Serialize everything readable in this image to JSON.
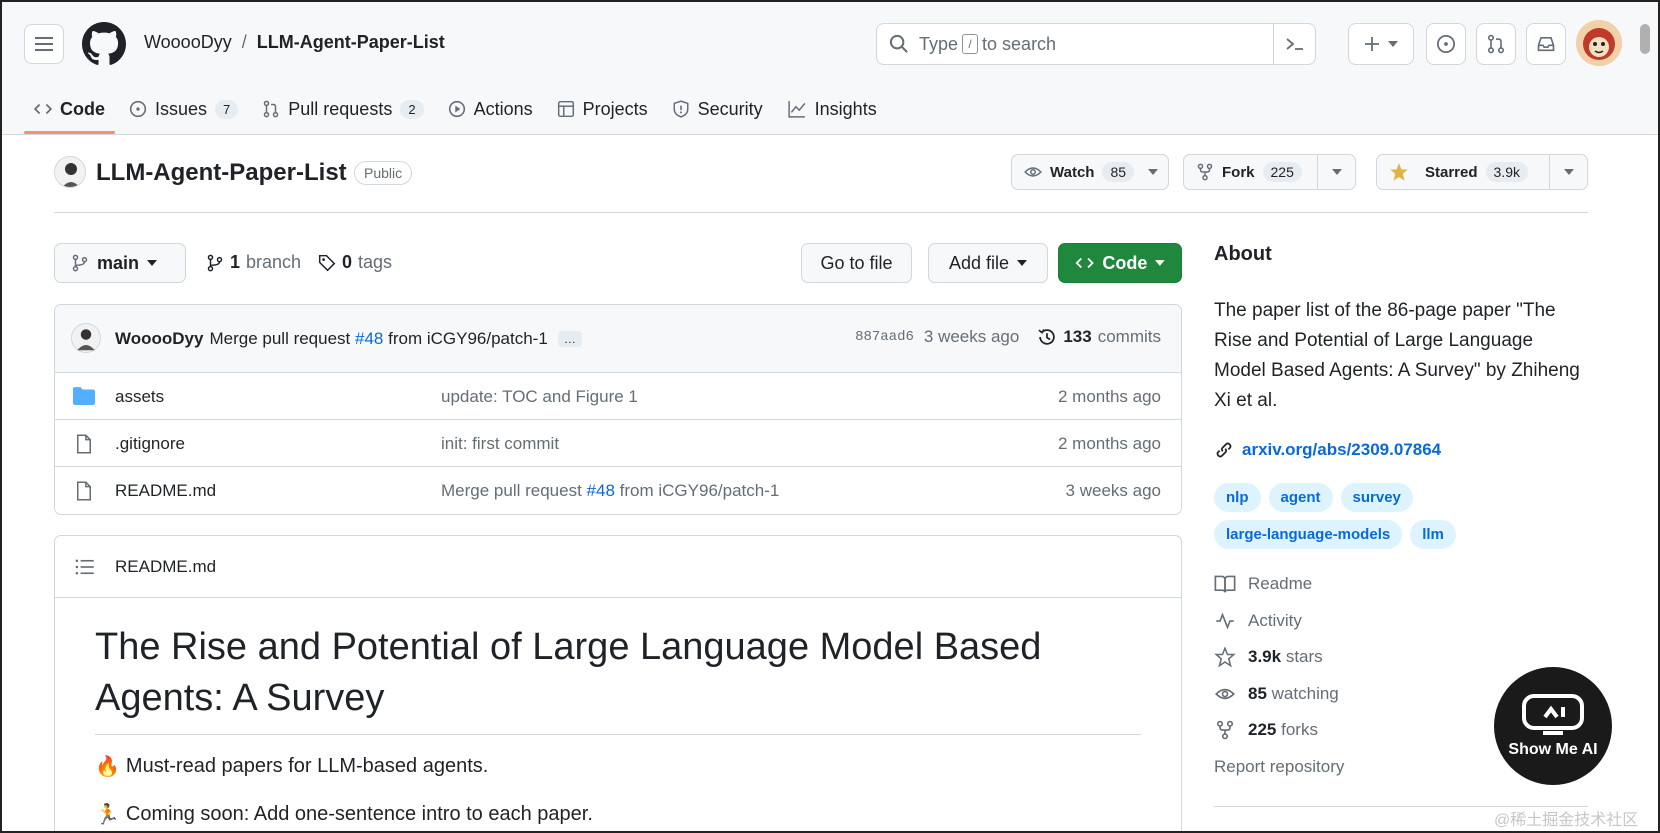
{
  "header": {
    "owner": "WooooDyy",
    "separator": "/",
    "repo": "LLM-Agent-Paper-List",
    "search_prefix": "Type",
    "search_key": "/",
    "search_suffix": "to search"
  },
  "tabs": [
    {
      "label": "Code",
      "icon": "code-icon",
      "active": true
    },
    {
      "label": "Issues",
      "count": "7",
      "icon": "issue-icon"
    },
    {
      "label": "Pull requests",
      "count": "2",
      "icon": "pull-request-icon"
    },
    {
      "label": "Actions",
      "icon": "play-icon"
    },
    {
      "label": "Projects",
      "icon": "table-icon"
    },
    {
      "label": "Security",
      "icon": "shield-icon"
    },
    {
      "label": "Insights",
      "icon": "graph-icon"
    }
  ],
  "repo": {
    "name": "LLM-Agent-Paper-List",
    "visibility": "Public",
    "watch_label": "Watch",
    "watch_count": "85",
    "fork_label": "Fork",
    "fork_count": "225",
    "star_label": "Starred",
    "star_count": "3.9k"
  },
  "branchbar": {
    "branch": "main",
    "branch_count": "1",
    "branch_word": "branch",
    "tag_count": "0",
    "tag_word": "tags",
    "go_to_file": "Go to file",
    "add_file": "Add file",
    "code": "Code"
  },
  "commit": {
    "author": "WooooDyy",
    "msg_prefix": "Merge pull request",
    "pr": "#48",
    "msg_suffix": "from iCGY96/patch-1",
    "ellipsis": "…",
    "sha": "887aad6",
    "when": "3 weeks ago",
    "commit_count": "133",
    "commit_word": "commits"
  },
  "files": [
    {
      "name": "assets",
      "type": "folder",
      "msg": "update: TOC and Figure 1",
      "date": "2 months ago"
    },
    {
      "name": ".gitignore",
      "type": "file",
      "msg": "init: first commit",
      "date": "2 months ago"
    },
    {
      "name": "README.md",
      "type": "file",
      "msg_prefix": "Merge pull request",
      "msg_pr": "#48",
      "msg_suffix": "from iCGY96/patch-1",
      "date": "3 weeks ago"
    }
  ],
  "readme": {
    "filename": "README.md",
    "title": "The Rise and Potential of Large Language Model Based Agents: A Survey",
    "line1_emoji": "🔥",
    "line1": "Must-read papers for LLM-based agents.",
    "line2_emoji": "🏃",
    "line2": "Coming soon: Add one-sentence intro to each paper."
  },
  "about": {
    "heading": "About",
    "description": "The paper list of the 86-page paper \"The Rise and Potential of Large Language Model Based Agents: A Survey\" by Zhiheng Xi et al.",
    "url": "arxiv.org/abs/2309.07864",
    "topics": [
      "nlp",
      "agent",
      "survey",
      "large-language-models",
      "llm"
    ],
    "readme": "Readme",
    "activity": "Activity",
    "stars_count": "3.9k",
    "stars_word": "stars",
    "watching_count": "85",
    "watching_word": "watching",
    "forks_count": "225",
    "forks_word": "forks",
    "report": "Report repository"
  },
  "overlay": {
    "badge": "Show Me AI",
    "watermark": "@稀土掘金技术社区"
  },
  "colors": {
    "accent": "#0969da",
    "green": "#1f883d",
    "tab_underline": "#fd8c73",
    "folder": "#54aeff"
  }
}
